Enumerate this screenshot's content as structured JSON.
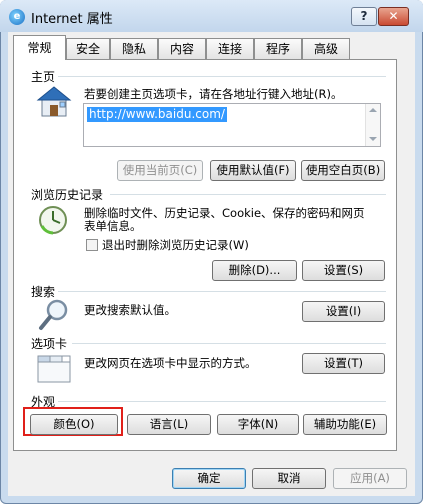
{
  "window": {
    "title": "Internet 属性",
    "help_label": "?",
    "close_label": "✕"
  },
  "tabs": [
    "常规",
    "安全",
    "隐私",
    "内容",
    "连接",
    "程序",
    "高级"
  ],
  "active_tab": "常规",
  "home": {
    "title": "主页",
    "description": "若要创建主页选项卡，请在各地址行键入地址(R)。",
    "url": "http://www.baidu.com/",
    "buttons": {
      "use_current": "使用当前页(C)",
      "use_default": "使用默认值(F)",
      "use_blank": "使用空白页(B)"
    }
  },
  "history": {
    "title": "浏览历史记录",
    "description_line1": "删除临时文件、历史记录、Cookie、保存的密码和网页",
    "description_line2": "表单信息。",
    "checkbox_label": "退出时删除浏览历史记录(W)",
    "delete_button": "删除(D)...",
    "settings_button": "设置(S)"
  },
  "search": {
    "title": "搜索",
    "description": "更改搜索默认值。",
    "settings_button": "设置(I)"
  },
  "tabs_section": {
    "title": "选项卡",
    "description": "更改网页在选项卡中显示的方式。",
    "settings_button": "设置(T)"
  },
  "appearance": {
    "title": "外观",
    "colors_button": "颜色(O)",
    "languages_button": "语言(L)",
    "fonts_button": "字体(N)",
    "accessibility_button": "辅助功能(E)"
  },
  "footer": {
    "ok_button": "确定",
    "cancel_button": "取消",
    "apply_button": "应用(A)"
  },
  "colors": {
    "highlight_border": "#e0201a",
    "url_selection": "#3399ff"
  }
}
